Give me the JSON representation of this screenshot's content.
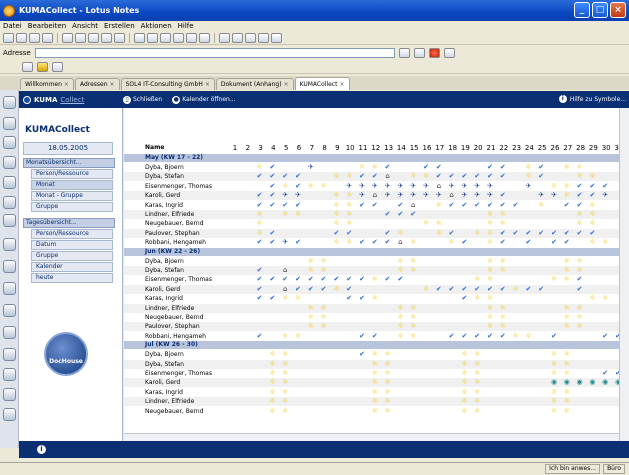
{
  "window": {
    "title": "KUMACollect - Lotus Notes"
  },
  "menu": [
    "Datei",
    "Bearbeiten",
    "Ansicht",
    "Erstellen",
    "Aktionen",
    "Hilfe"
  ],
  "address": {
    "label": "Adresse"
  },
  "tabs": [
    {
      "label": "Willkommen"
    },
    {
      "label": "Adressen"
    },
    {
      "label": "SOL4 IT-Consulting GmbH"
    },
    {
      "label": "Dokument (Anhang)"
    },
    {
      "label": "KUMACollect",
      "active": true
    }
  ],
  "content_bar": {
    "brand": "KUMA",
    "brand_suffix": "Collect",
    "close": "Schließen",
    "calendar": "Kalender öffnen...",
    "help": "Hilfe zu Symbole..."
  },
  "nav": {
    "title": "KUMACollect",
    "date": "18.05.2005",
    "groups": [
      {
        "label": "Monatsübersicht...",
        "items": [
          "Person/Ressource",
          "Monat",
          "Monat - Gruppe",
          "Gruppe"
        ],
        "selected": 1
      },
      {
        "label": "Tagesübersicht...",
        "items": [
          "Person/Ressource",
          "Datum",
          "Gruppe",
          "Kalender",
          "heute"
        ],
        "selected": -1
      }
    ],
    "logo": "DocHouse"
  },
  "grid": {
    "name_header": "Name",
    "days": [
      "1",
      "2",
      "3",
      "4",
      "5",
      "6",
      "7",
      "8",
      "9",
      "10",
      "11",
      "12",
      "13",
      "14",
      "15",
      "16",
      "17",
      "18",
      "19",
      "20",
      "21",
      "22",
      "23",
      "24",
      "25",
      "26",
      "27",
      "28",
      "29",
      "30",
      "31"
    ],
    "weeks": [
      {
        "label": "May (KW 17 - 22)",
        "rows": [
          [
            "Dyba, Bjoern",
            "..SC..P...SSC..CC...CC.SC.SS..."
          ],
          [
            "Dyba, Stefan",
            "..CCCC..SSCCH.SSCCCCCC.SC..SS.."
          ],
          [
            "Eisenmenger, Thomas",
            "...CSCSS.PPPPPPPHPPPP..P.SSCCC."
          ],
          [
            "Karoli, Gerd",
            "..CCPP..SSPHPPPPPHPPPC..PPSCCP."
          ],
          [
            "Karas, Ingrid",
            "..CCCC..SSCC.CH.SCCCCCC.S.CCS.."
          ],
          [
            "Lindner, Elfriede",
            "..S.SS..SS..CCC.....SS.....SS.."
          ],
          [
            "Neugebauer, Bernd",
            "..S.....SS.....SS...SS.....SS.."
          ],
          [
            "Paulover, Stephan",
            "..SC....CC..CS..SC.SSCCCCCCCC.."
          ],
          [
            "Robbani, Hengameh",
            "..CCPC..SSCCCHS..SC.SC.C.CC.SS."
          ]
        ]
      },
      {
        "label": "Jun (KW 22 - 26)",
        "rows": [
          [
            "Dyba, Bjoern",
            "......SS.....SS.....SS....SS..."
          ],
          [
            "Dyba, Stefan",
            "..C.H.SS.....SS.....SS....SS..."
          ],
          [
            "Eisenmenger, Thomas",
            "..CCCCCCCCCSCC.....SS....SSC..."
          ],
          [
            "Karoli, Gerd",
            "..C.HCCCSC.....SCCCCCCSCC..C..."
          ],
          [
            "Karas, Ingrid",
            "..CCSS...CCS......CSS.......SS"
          ],
          [
            "Lindner, Elfriede",
            "......SS.....SS.....SS....SS..."
          ],
          [
            "Neugebauer, Bernd",
            "......SS.....SS.....SS....SS..."
          ],
          [
            "Paulover, Stephan",
            "......SS.....SS.....SS....SS..."
          ],
          [
            "Robbani, Hengameh",
            "..C.SS....CC.SS..CCCCCSS.C...CC"
          ]
        ]
      },
      {
        "label": "Jul (KW 26 - 30)",
        "rows": [
          [
            "Dyba, Bjoern",
            "...SS.....CSS.....SS.....SS...."
          ],
          [
            "Dyba, Stefan",
            "...SS......SS.....SS.....SS...."
          ],
          [
            "Eisenmenger, Thomas",
            "...SS......SS.....SS.....SS..CC"
          ],
          [
            "Karoli, Gerd",
            "...SS......SS.....SS.....OOOOOO"
          ],
          [
            "Karas, Ingrid",
            "...SS......SS.....SS.....SS...."
          ],
          [
            "Lindner, Elfriede",
            "...SS......SS.....SS.....SS...."
          ],
          [
            "Neugebauer, Bernd",
            "...SS......SS.....SS.....SS...."
          ]
        ]
      }
    ]
  },
  "status": [
    "Ich bin anwes...",
    "Büro"
  ]
}
